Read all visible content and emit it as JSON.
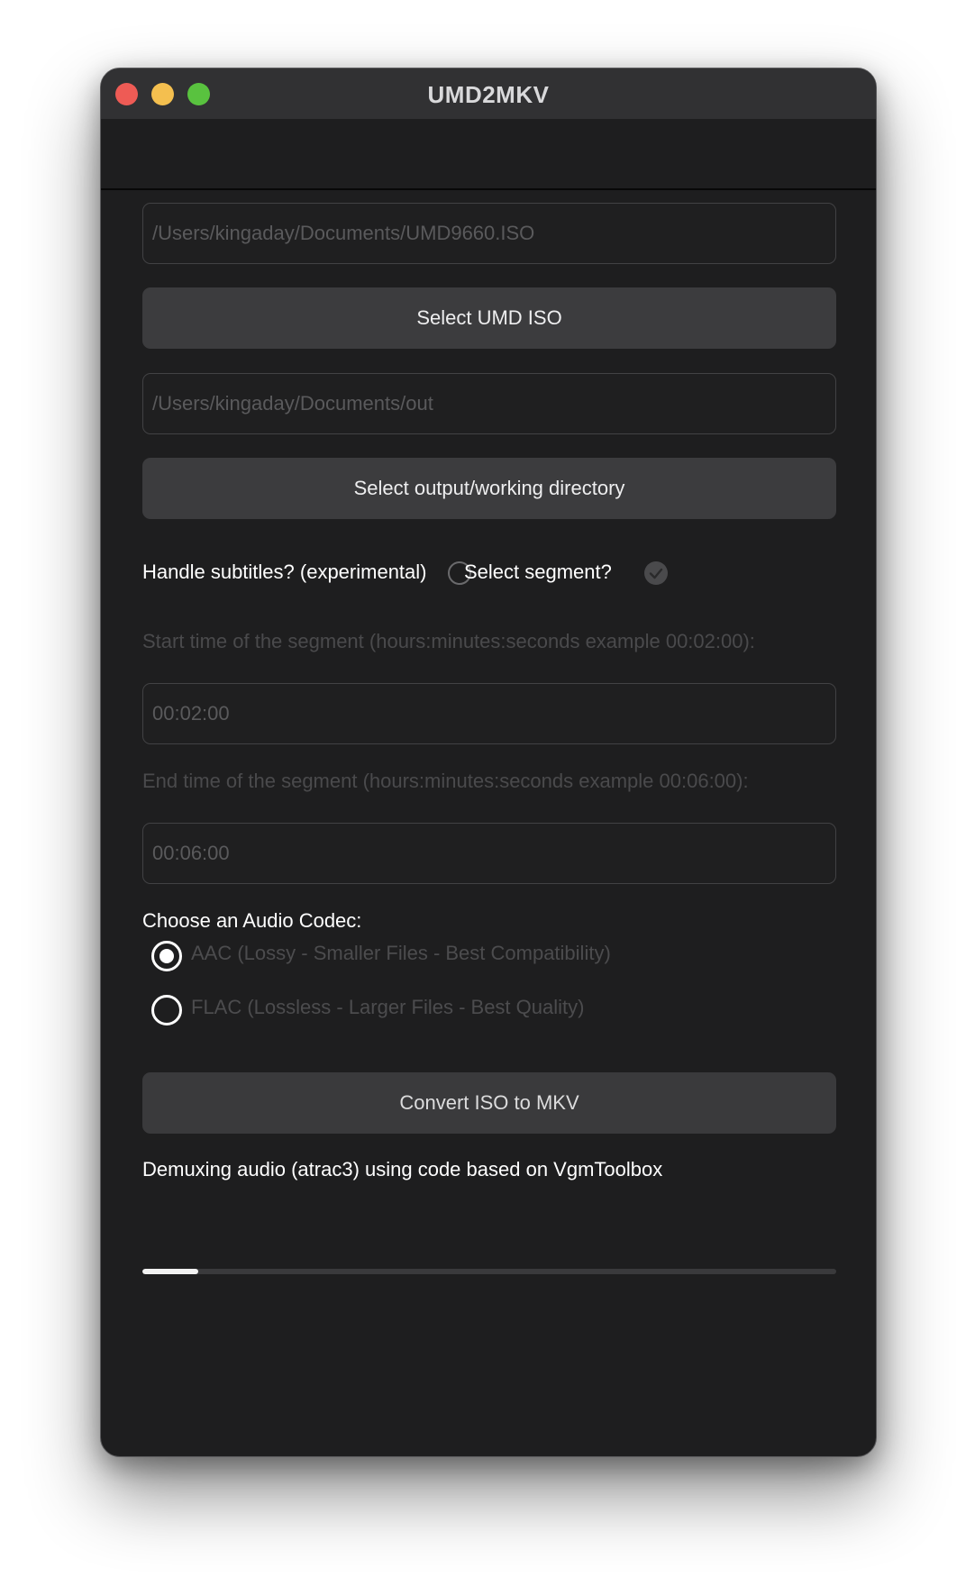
{
  "window": {
    "title": "UMD2MKV"
  },
  "iso_path": {
    "value": "/Users/kingaday/Documents/UMD9660.ISO"
  },
  "select_iso_button": {
    "label": "Select UMD ISO"
  },
  "output_path": {
    "value": "/Users/kingaday/Documents/out"
  },
  "select_output_button": {
    "label": "Select output/working directory"
  },
  "options": {
    "subtitles_label": "Handle subtitles? (experimental)",
    "subtitles_checked": false,
    "segment_label": "Select segment?",
    "segment_checked": true
  },
  "segment": {
    "start_label": "Start time of the segment (hours:minutes:seconds  example 00:02:00):",
    "start_value": "00:02:00",
    "end_label": "End time of the segment (hours:minutes:seconds  example 00:06:00):",
    "end_value": "00:06:00"
  },
  "audio": {
    "heading": "Choose an Audio Codec:",
    "options": [
      {
        "label": "AAC (Lossy - Smaller Files - Best Compatibility)",
        "selected": true
      },
      {
        "label": "FLAC (Lossless - Larger Files - Best Quality)",
        "selected": false
      }
    ]
  },
  "convert_button": {
    "label": "Convert ISO to MKV"
  },
  "status": {
    "text": "Demuxing audio (atrac3) using code based on VgmToolbox"
  },
  "progress": {
    "fraction": 0.08
  },
  "colors": {
    "background": "#1e1e1f",
    "button": "#3c3c3e",
    "close": "#ee5b55",
    "minimize": "#f4bf4f",
    "maximize": "#59c23f"
  }
}
